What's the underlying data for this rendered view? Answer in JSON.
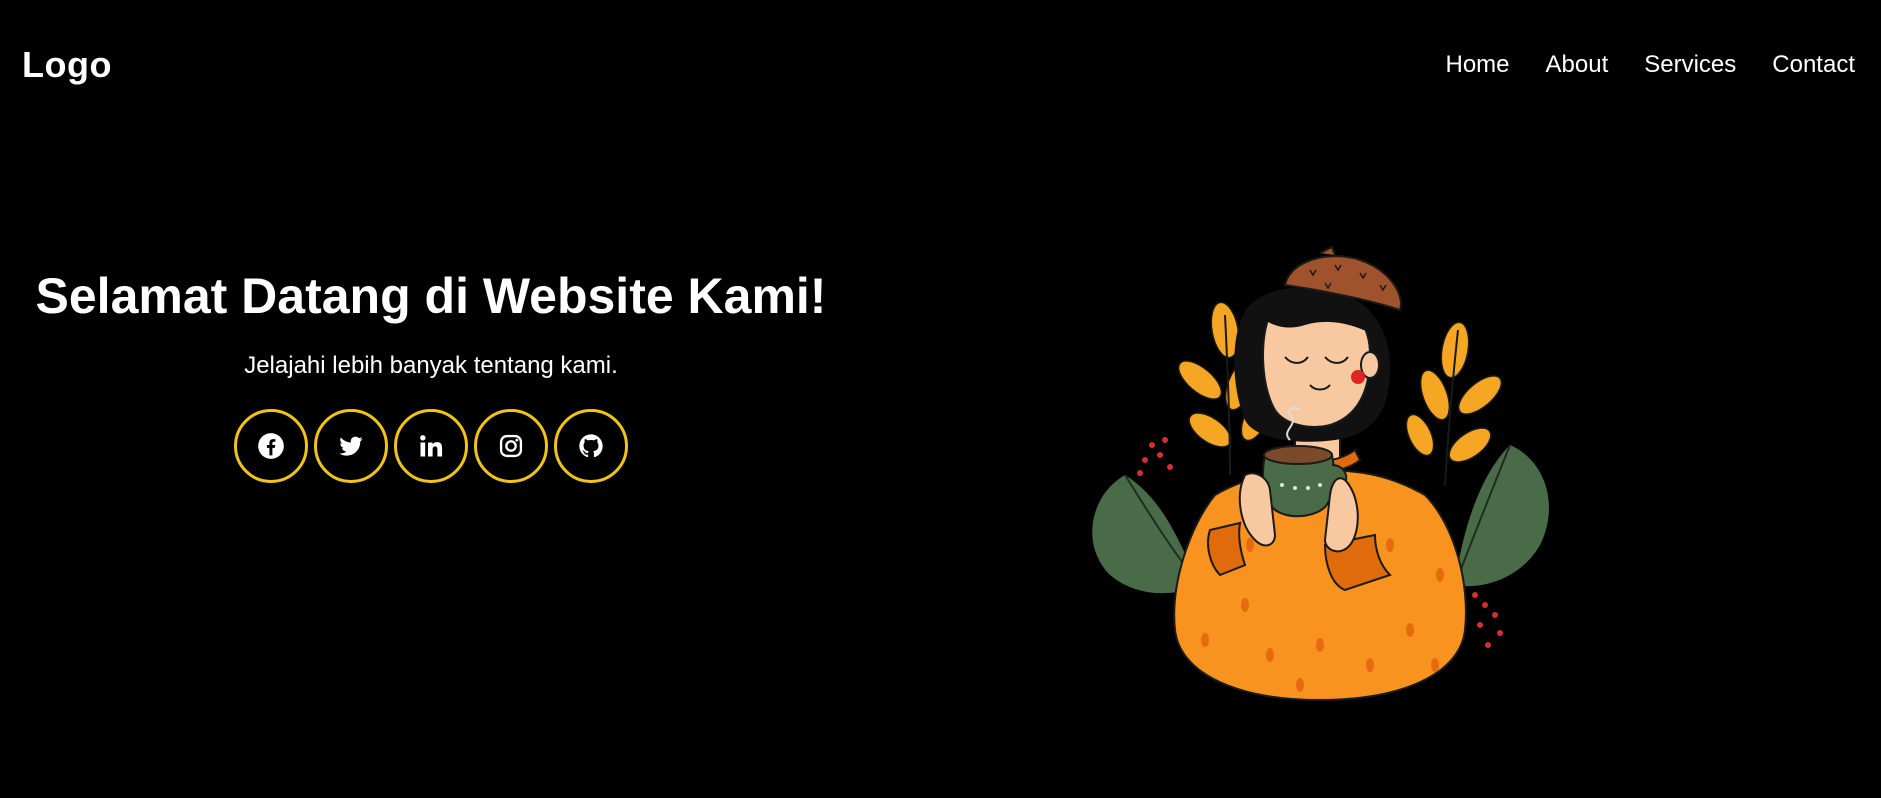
{
  "header": {
    "logo": "Logo",
    "nav": [
      {
        "label": "Home"
      },
      {
        "label": "About"
      },
      {
        "label": "Services"
      },
      {
        "label": "Contact"
      }
    ]
  },
  "hero": {
    "title": "Selamat Datang di Website Kami!",
    "subtitle": "Jelajahi lebih banyak tentang kami.",
    "socials": [
      {
        "icon": "facebook-icon"
      },
      {
        "icon": "twitter-icon"
      },
      {
        "icon": "linkedin-icon"
      },
      {
        "icon": "instagram-icon"
      },
      {
        "icon": "github-icon"
      }
    ]
  },
  "colors": {
    "background": "#000000",
    "text": "#ffffff",
    "accent": "#f0c419",
    "sweater": "#f7931e",
    "leaf_yellow": "#f5a623",
    "leaf_green": "#4a6b48",
    "beret": "#a0522d"
  }
}
